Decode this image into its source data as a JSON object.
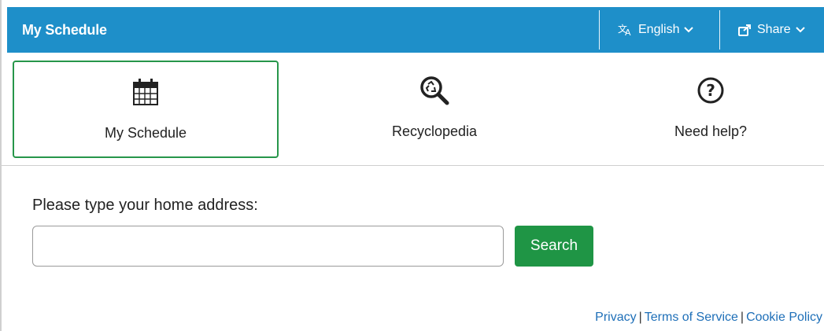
{
  "header": {
    "title": "My Schedule",
    "language": {
      "icon": "translate-icon",
      "label": "English",
      "caret": "chevron-down-icon"
    },
    "share": {
      "icon": "share-icon",
      "label": "Share",
      "caret": "chevron-down-icon"
    },
    "background_color": "#1e8fc9"
  },
  "tiles": [
    {
      "label": "My Schedule",
      "icon": "calendar-icon",
      "active": true
    },
    {
      "label": "Recyclopedia",
      "icon": "recycle-search-icon",
      "active": false
    },
    {
      "label": "Need help?",
      "icon": "help-icon",
      "active": false
    }
  ],
  "address_form": {
    "prompt": "Please type your home address:",
    "input_value": "",
    "input_placeholder": "",
    "search_label": "Search",
    "search_color": "#1f9545"
  },
  "footer": {
    "links": [
      "Privacy",
      "Terms of Service",
      "Cookie Policy"
    ],
    "separator": "|",
    "link_color": "#1e6fb8"
  },
  "accent_active_tile_border": "#27964a"
}
